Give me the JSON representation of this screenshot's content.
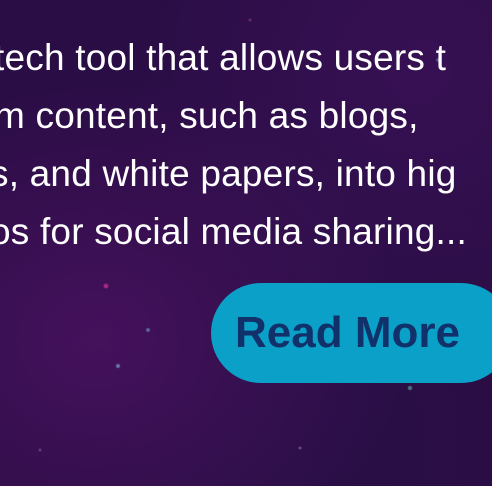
{
  "description": {
    "lines": [
      "tech tool that allows users t",
      "m content, such as blogs,",
      "s, and white papers, into hig",
      "os for social media sharing..."
    ]
  },
  "read_more": {
    "label": "Read More"
  },
  "colors": {
    "background": "#2a0d45",
    "button_bg": "#0aa0c8",
    "button_text": "#11316b",
    "text": "#ffffff"
  }
}
